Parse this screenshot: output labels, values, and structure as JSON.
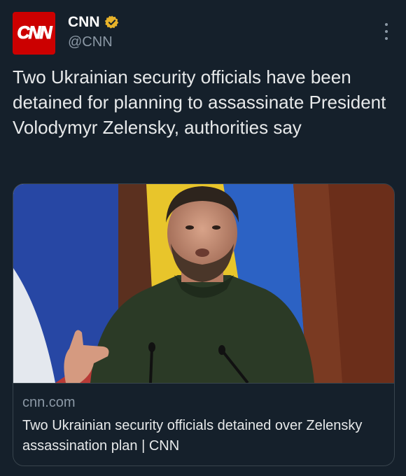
{
  "account": {
    "avatar_text": "CNN",
    "display_name": "CNN",
    "handle": "@CNN",
    "verified_icon": "verified-badge-icon",
    "brand_color": "#cc0000",
    "verified_color": "#e8b32a"
  },
  "tweet": {
    "text": "Two Ukrainian security officials have been detained for planning to assassinate President Volodymyr Zelensky, authorities say"
  },
  "link_card": {
    "domain": "cnn.com",
    "title": "Two Ukrainian security officials detained over Zelensky assassination plan | CNN"
  },
  "menu": {
    "more_icon": "more-options-icon"
  }
}
